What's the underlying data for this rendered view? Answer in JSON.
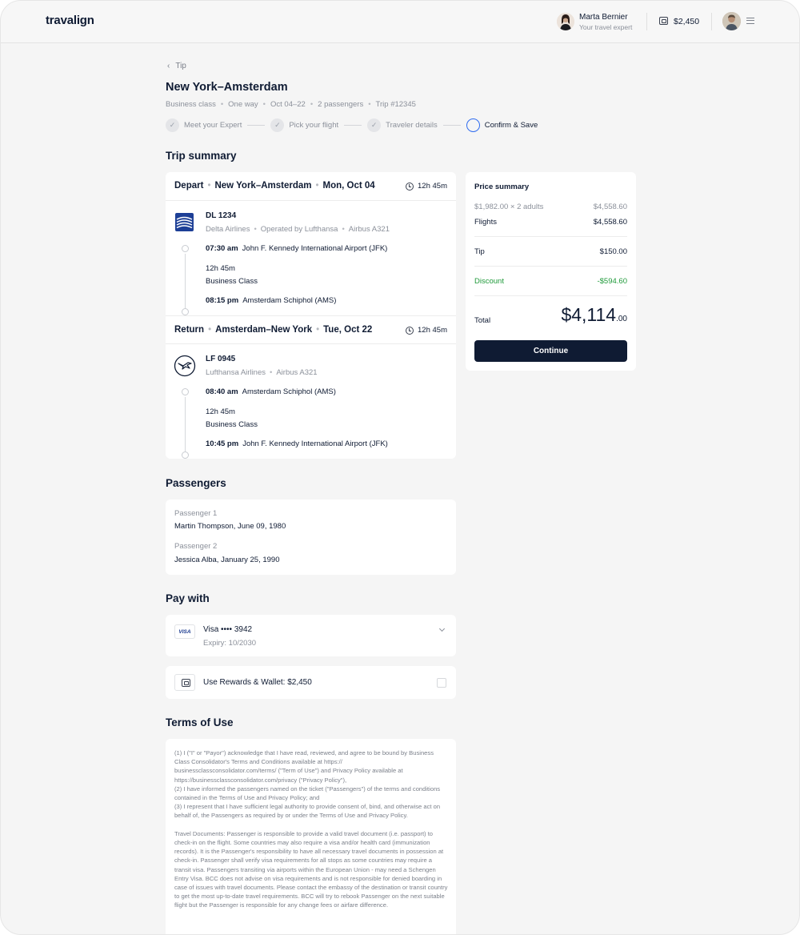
{
  "header": {
    "logo": "travalign",
    "expert": {
      "name": "Marta Bernier",
      "role": "Your travel expert"
    },
    "wallet_amount": "$2,450"
  },
  "page": {
    "back_label": "Tip",
    "title": "New York–Amsterdam",
    "meta": [
      "Business class",
      "One way",
      "Oct 04–22",
      "2 passengers",
      "Trip #12345"
    ]
  },
  "stepper": [
    {
      "label": "Meet your Expert",
      "state": "done"
    },
    {
      "label": "Pick your flight",
      "state": "done"
    },
    {
      "label": "Traveler details",
      "state": "done"
    },
    {
      "label": "Confirm & Save",
      "state": "active"
    }
  ],
  "sections": {
    "trip_summary": "Trip summary",
    "passengers": "Passengers",
    "pay_with": "Pay with",
    "terms": "Terms of Use"
  },
  "flights": {
    "depart": {
      "kind": "Depart",
      "route": "New York–Amsterdam",
      "date": "Mon, Oct 04",
      "duration": "12h 45m",
      "flight_no": "DL 1234",
      "airline": "Delta Airlines",
      "operated": "Operated by Lufthansa",
      "aircraft": "Airbus A321",
      "dep_time": "07:30 am",
      "dep_airport": "John F. Kennedy International Airport (JFK)",
      "seg_duration": "12h 45m",
      "cabin": "Business Class",
      "arr_time": "08:15 pm",
      "arr_airport": "Amsterdam Schiphol (AMS)"
    },
    "return": {
      "kind": "Return",
      "route": "Amsterdam–New York",
      "date": "Tue, Oct 22",
      "duration": "12h 45m",
      "flight_no": "LF 0945",
      "airline": "Lufthansa Airlines",
      "aircraft": "Airbus A321",
      "dep_time": "08:40 am",
      "dep_airport": "Amsterdam Schiphol (AMS)",
      "seg_duration": "12h 45m",
      "cabin": "Business Class",
      "arr_time": "10:45 pm",
      "arr_airport": "John F. Kennedy International Airport (JFK)"
    }
  },
  "passengers": [
    {
      "label": "Passenger 1",
      "value": "Martin Thompson, June 09, 1980"
    },
    {
      "label": "Passenger 2",
      "value": "Jessica Alba, January 25, 1990"
    }
  ],
  "payment": {
    "brand_badge": "VISA",
    "card_label": "Visa  ••••  3942",
    "expiry": "Expiry: 10/2030",
    "rewards_label": "Use Rewards & Wallet: $2,450"
  },
  "terms": {
    "text": "(1) I (\"I\" or \"Payor\") acknowledge that I have read, reviewed, and agree to be bound by Business Class Consolidator's Terms and Conditions available at https://\nbusinessclassconsolidator.com/terms/ (\"Term of Use\") and Privacy Policy available at https://businessclassconsolidator.com/privacy (\"Privacy Policy\"),\n(2) I have informed the passengers named on the ticket (\"Passengers\") of the terms and conditions contained in the Terms of Use and Privacy Policy; and\n(3) I represent that I have sufficient legal authority to provide consent of, bind, and otherwise act on behalf of, the Passengers as required by or under the Terms of Use and Privacy Policy.\n\nTravel Documents: Passenger is responsible to provide a valid travel document (i.e. passport) to check-in on the flight. Some countries may also require a visa and/or health card (immunization records). It is the Passenger's responsibility to have all necessary travel documents in possession at check-in. Passenger shall verify visa requirements for all stops as some countries may require a transit visa. Passengers transiting via airports within the European Union - may need a Schengen Entry Visa. BCC does not advise on visa requirements and is not responsible for denied boarding in case of issues with travel documents. Please contact the embassy of the destination or transit country to get the most up-to-date travel requirements. BCC will try to rebook Passenger on the next suitable flight but the Passenger is responsible for any change fees or airfare difference."
  },
  "price_summary": {
    "title": "Price summary",
    "fare_line": {
      "label": "$1,982.00 × 2 adults",
      "value": "$4,558.60"
    },
    "flights": {
      "label": "Flights",
      "value": "$4,558.60"
    },
    "tip": {
      "label": "Tip",
      "value": "$150.00"
    },
    "discount": {
      "label": "Discount",
      "value": "-$594.60"
    },
    "total_label": "Total",
    "total_main": "$4,114",
    "total_cents": ".00",
    "continue_label": "Continue"
  },
  "colors": {
    "primary": "#0f1b33",
    "accent": "#2f6cf0",
    "discount": "#1f9a3a"
  }
}
